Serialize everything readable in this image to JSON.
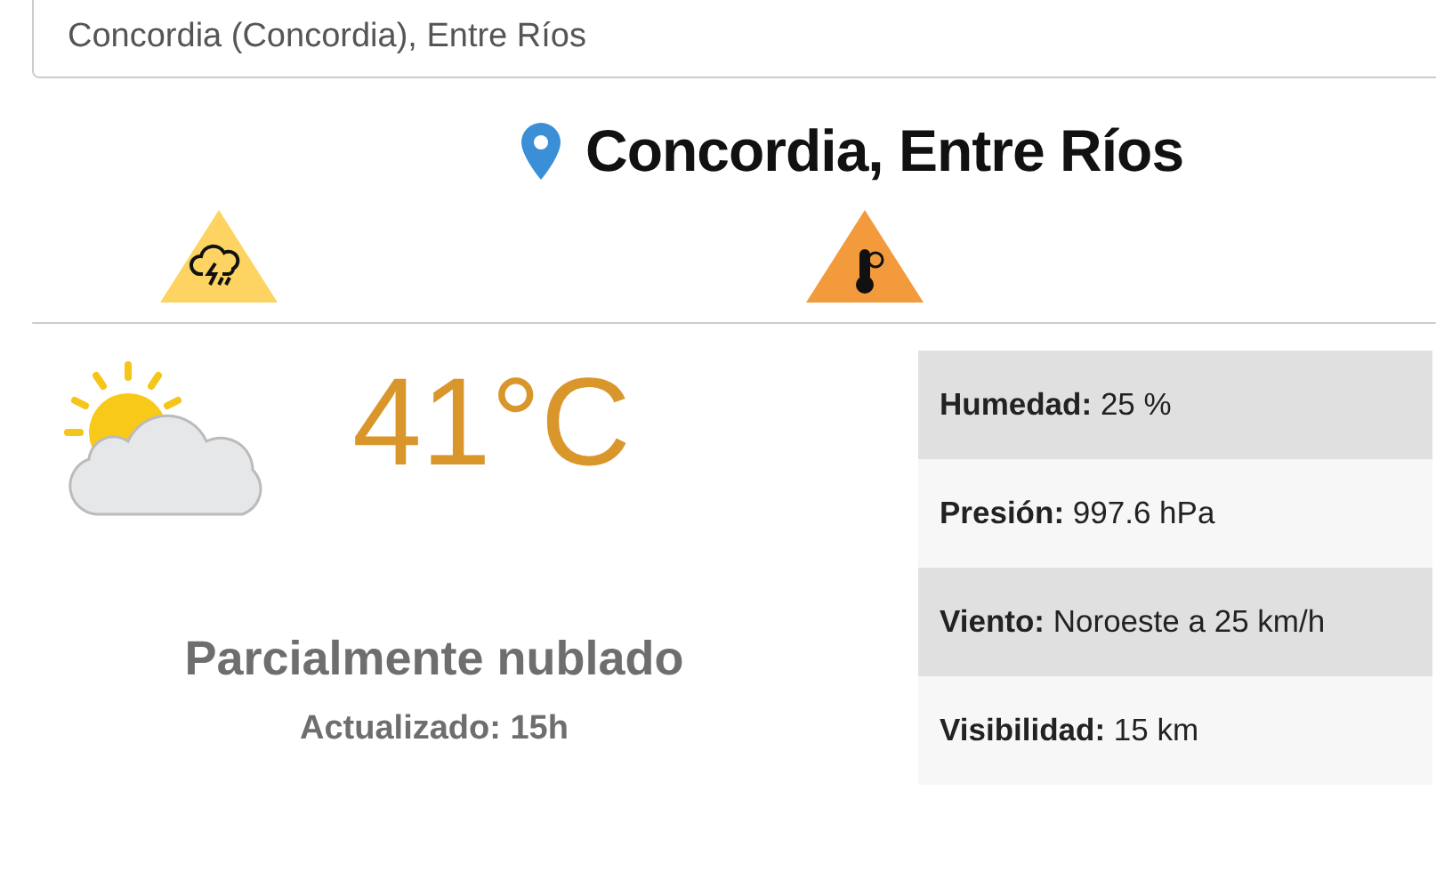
{
  "search": {
    "value": "Concordia (Concordia), Entre Ríos"
  },
  "location": {
    "title": "Concordia, Entre Ríos"
  },
  "alerts": [
    {
      "kind": "storm",
      "color": "#fdd462"
    },
    {
      "kind": "heat",
      "color": "#f39a3c"
    }
  ],
  "current": {
    "temperature": "41°C",
    "condition": "Parcialmente nublado",
    "updated": "Actualizado: 15h"
  },
  "details": [
    {
      "label": "Humedad:",
      "value": "25 %"
    },
    {
      "label": "Presión:",
      "value": "997.6 hPa"
    },
    {
      "label": "Viento:",
      "value": "Noroeste a 25 km/h"
    },
    {
      "label": "Visibilidad:",
      "value": "15 km"
    }
  ]
}
